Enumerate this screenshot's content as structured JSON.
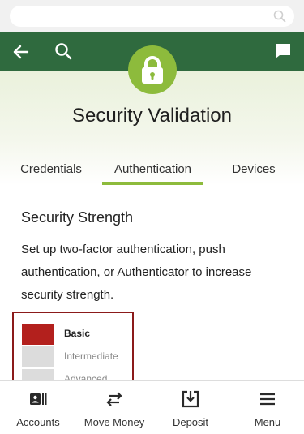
{
  "header": {
    "title": "Security Validation"
  },
  "tabs": [
    {
      "label": "Credentials"
    },
    {
      "label": "Authentication"
    },
    {
      "label": "Devices"
    }
  ],
  "active_tab": "Authentication",
  "section": {
    "title": "Security Strength",
    "description": "Set up two-factor authentication, push authentication, or Authenticator to increase security strength."
  },
  "strength": {
    "current": "Basic",
    "levels": [
      {
        "label": "Basic",
        "color": "#b3201d"
      },
      {
        "label": "Intermediate",
        "color": "#dcdcdc"
      },
      {
        "label": "Advanced",
        "color": "#dcdcdc"
      }
    ]
  },
  "bottom_nav": [
    {
      "label": "Accounts",
      "icon": "accounts-icon"
    },
    {
      "label": "Move Money",
      "icon": "transfer-arrows-icon"
    },
    {
      "label": "Deposit",
      "icon": "deposit-icon"
    },
    {
      "label": "Menu",
      "icon": "menu-icon"
    }
  ],
  "colors": {
    "header_green": "#2f6a3e",
    "accent_green": "#8dbb3c",
    "strength_border": "#8b1a1a"
  }
}
